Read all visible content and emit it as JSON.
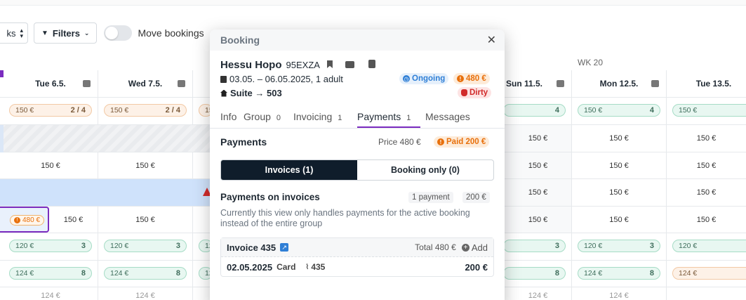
{
  "toolbar": {
    "select_fragment": "ks",
    "filters_label": "Filters",
    "move_bookings_label": "Move bookings"
  },
  "calendar": {
    "week_label": "WK 20",
    "days": [
      {
        "label": "Tue 6.5."
      },
      {
        "label": "Wed 7.5."
      },
      {
        "label": "Sun 11.5."
      },
      {
        "label": "Mon 12.5."
      },
      {
        "label": "Tue 13.5."
      }
    ],
    "rate_row": [
      {
        "price": "150 €",
        "avail": "2 / 4",
        "style": "peach"
      },
      {
        "price": "150 €",
        "avail": "2 / 4",
        "style": "peach"
      },
      {
        "price": "15",
        "avail": "",
        "style": "peach"
      },
      {
        "price": "",
        "avail": "4",
        "style": "mint"
      },
      {
        "price": "150 €",
        "avail": "4",
        "style": "mint"
      },
      {
        "price": "150 €",
        "avail": "",
        "style": "mint"
      }
    ],
    "price_cell": "150 €",
    "alert_badge": "480 €",
    "row_120": {
      "price": "120 €",
      "avail": "3",
      "partial": "12"
    },
    "row_124": {
      "price": "124 €",
      "avail": "8",
      "partial": "12"
    },
    "row_bottom": "124 €"
  },
  "modal": {
    "title": "Booking",
    "guest_name": "Hessu Hopo",
    "booking_code": "95EXZA",
    "dates": "03.05. – 06.05.2025, 1 adult",
    "room": "Suite → 503",
    "status_ongoing": "Ongoing",
    "status_amount": "480 €",
    "status_dirty": "Dirty",
    "tabs": [
      {
        "label": "Info",
        "count": ""
      },
      {
        "label": "Group",
        "count": "0"
      },
      {
        "label": "Invoicing",
        "count": "1"
      },
      {
        "label": "Payments",
        "count": "1"
      },
      {
        "label": "Messages",
        "count": ""
      }
    ],
    "payments_title": "Payments",
    "price_label": "Price 480 €",
    "paid_label": "Paid 200 €",
    "seg_invoices": "Invoices (1)",
    "seg_booking_only": "Booking only (0)",
    "payments_on_invoices": "Payments on invoices",
    "payment_count": "1 payment",
    "payment_total": "200 €",
    "note": "Currently this view only handles payments for the active booking instead of the entire group",
    "invoice": {
      "title": "Invoice 435",
      "total": "Total 480 €",
      "add": "Add",
      "date": "02.05.2025",
      "method": "Card",
      "ref": "435",
      "amount": "200 €"
    }
  },
  "colors": {
    "accent_purple": "#7b2cbf",
    "ongoing_blue": "#2f7fd6",
    "orange": "#e8700c",
    "dirty_red": "#d12b2b",
    "dark_segment": "#0f1d2b"
  }
}
